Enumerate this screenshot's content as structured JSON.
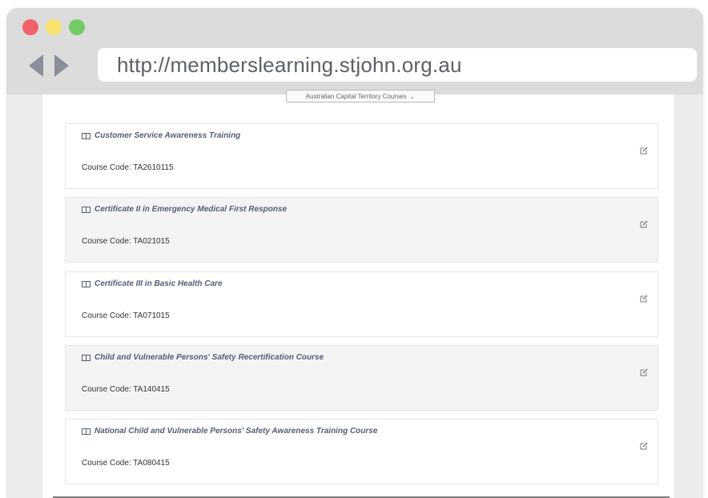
{
  "browser": {
    "url": "http://memberslearning.stjohn.org.au"
  },
  "filter": {
    "selected": "Australian Capital Territory Courses"
  },
  "courses": [
    {
      "title": "Customer Service Awareness Training",
      "code": "Course Code: TA2610115"
    },
    {
      "title": "Certificate II in Emergency Medical First Response",
      "code": "Course Code: TA021015"
    },
    {
      "title": "Certificate III in Basic Health Care",
      "code": "Course Code: TA071015"
    },
    {
      "title": "Child and Vulnerable Persons' Safety Recertification Course",
      "code": "Course Code: TA140415"
    },
    {
      "title": "National Child and Vulnerable Persons' Safety Awareness Training Course",
      "code": "Course Code: TA080415"
    }
  ],
  "icons": {
    "course": "book-icon",
    "action": "edit-icon"
  }
}
